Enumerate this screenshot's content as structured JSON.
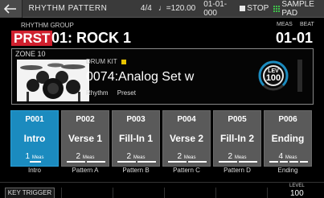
{
  "topbar": {
    "title": "RHYTHM PATTERN",
    "time_signature": "4/4",
    "tempo": "♩=120.00",
    "position": "01-01-000",
    "transport": "STOP",
    "mode": "SAMPLE PAD"
  },
  "header": {
    "group_label": "RHYTHM GROUP",
    "badge": "PRST",
    "group_name": "01: ROCK 1",
    "meas_label": "MEAS",
    "beat_label": "BEAT",
    "meas_beat": "01-01"
  },
  "zone": {
    "label": "ZONE 10",
    "kit_caption": "DRUM KIT",
    "kit_name": "0074:Analog Set w",
    "tags": [
      "Rhythm",
      "Preset"
    ],
    "lev_label": "LEV",
    "lev_value": "100"
  },
  "patterns": [
    {
      "num": "P001",
      "name": "Intro",
      "meas": "1",
      "meas_unit": "Meas",
      "bars": 1,
      "caption": "Intro",
      "active": true
    },
    {
      "num": "P002",
      "name": "Verse 1",
      "meas": "2",
      "meas_unit": "Meas",
      "bars": 2,
      "caption": "Pattern A",
      "active": false
    },
    {
      "num": "P003",
      "name": "Fill-In 1",
      "meas": "2",
      "meas_unit": "Meas",
      "bars": 2,
      "caption": "Pattern B",
      "active": false
    },
    {
      "num": "P004",
      "name": "Verse 2",
      "meas": "2",
      "meas_unit": "Meas",
      "bars": 2,
      "caption": "Pattern C",
      "active": false
    },
    {
      "num": "P005",
      "name": "Fill-In 2",
      "meas": "2",
      "meas_unit": "Meas",
      "bars": 2,
      "caption": "Pattern D",
      "active": false
    },
    {
      "num": "P006",
      "name": "Ending",
      "meas": "4",
      "meas_unit": "Meas",
      "bars": 4,
      "caption": "Ending",
      "active": false
    }
  ],
  "bottom": {
    "key_trigger": "KEY TRIGGER",
    "level_label": "LEVEL",
    "level_value": "100"
  },
  "colors": {
    "active_pattern": "#1b8bbf",
    "badge": "#d0202e",
    "lev_ring": "#1b8bbf"
  },
  "icons": {
    "back": "arrow-left-icon",
    "stop": "stop-icon",
    "sample_pad": "grid-icon",
    "drum_kit_star": "star-icon"
  }
}
